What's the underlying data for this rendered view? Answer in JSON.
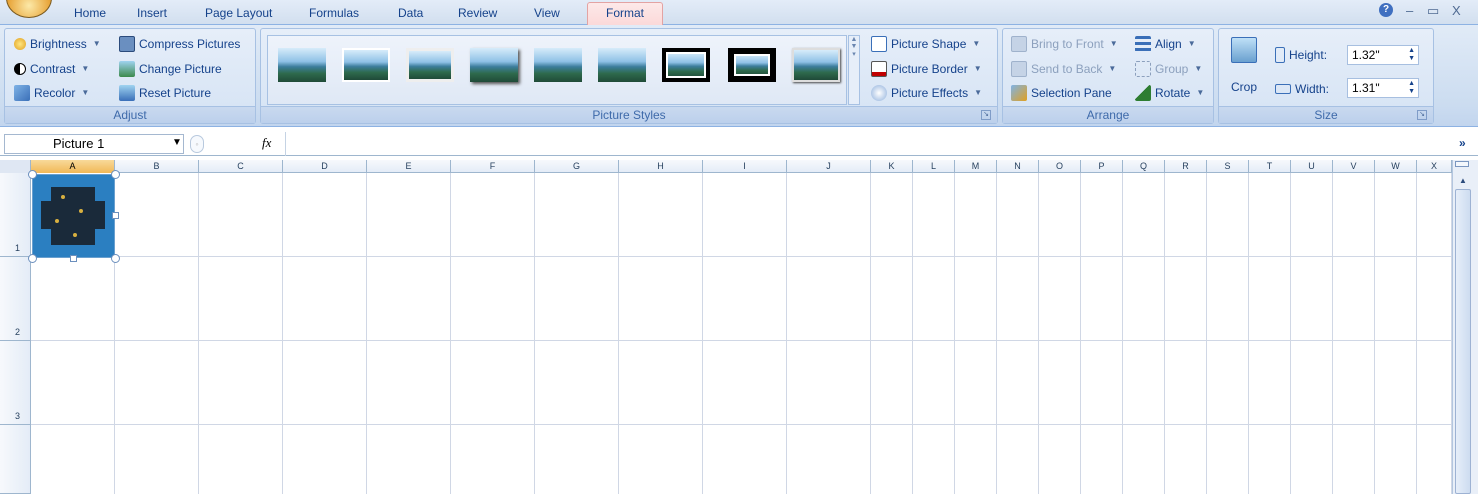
{
  "tabs": [
    {
      "label": "Home"
    },
    {
      "label": "Insert"
    },
    {
      "label": "Page Layout"
    },
    {
      "label": "Formulas"
    },
    {
      "label": "Data"
    },
    {
      "label": "Review"
    },
    {
      "label": "View"
    },
    {
      "label": "Format",
      "active": true
    }
  ],
  "window_controls": {
    "help": "?",
    "minimize": "–",
    "restore": "▭",
    "close": "X"
  },
  "ribbon": {
    "adjust": {
      "label": "Adjust",
      "brightness": "Brightness",
      "contrast": "Contrast",
      "recolor": "Recolor",
      "compress": "Compress Pictures",
      "change": "Change Picture",
      "reset": "Reset Picture"
    },
    "picture_styles": {
      "label": "Picture Styles",
      "shape": "Picture Shape",
      "border": "Picture Border",
      "effects": "Picture Effects",
      "thumbnail_count": 9
    },
    "arrange": {
      "label": "Arrange",
      "bring_front": "Bring to Front",
      "send_back": "Send to Back",
      "selection_pane": "Selection Pane",
      "align": "Align",
      "group": "Group",
      "rotate": "Rotate"
    },
    "size": {
      "label": "Size",
      "crop": "Crop",
      "height_label": "Height:",
      "height_value": "1.32\"",
      "width_label": "Width:",
      "width_value": "1.31\""
    }
  },
  "formula_bar": {
    "name_box": "Picture 1",
    "fx": "fx",
    "formula": ""
  },
  "grid": {
    "columns": [
      "A",
      "B",
      "C",
      "D",
      "E",
      "F",
      "G",
      "H",
      "I",
      "J",
      "K",
      "L",
      "M",
      "N",
      "O",
      "P",
      "Q",
      "R",
      "S",
      "T",
      "U",
      "V",
      "W",
      "X"
    ],
    "rows": [
      "1",
      "2",
      "3"
    ],
    "selected_column": "A"
  },
  "colors": {
    "ribbon_text": "#15428b",
    "active_tab": "#fbd8d8",
    "selected_header": "#f1b857"
  },
  "icons": [
    "brightness-icon",
    "contrast-icon",
    "recolor-icon",
    "compress-icon",
    "change-picture-icon",
    "reset-picture-icon",
    "picture-shape-icon",
    "picture-border-icon",
    "picture-effects-icon",
    "bring-front-icon",
    "send-back-icon",
    "selection-pane-icon",
    "align-icon",
    "group-icon",
    "rotate-icon",
    "crop-icon",
    "height-icon",
    "width-icon"
  ]
}
